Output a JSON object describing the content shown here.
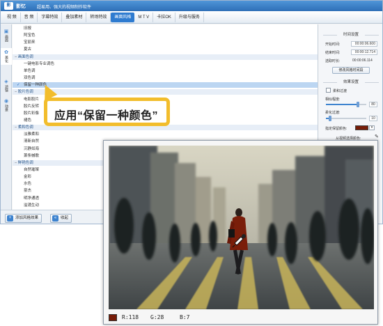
{
  "app": {
    "logo_text": "影",
    "name": "影忆",
    "subtitle": "超易用、强大的视频制作软件"
  },
  "menu": {
    "tabs": [
      {
        "label": "视 频"
      },
      {
        "label": "音 频"
      },
      {
        "label": "字幕特效"
      },
      {
        "label": "叠加素材"
      },
      {
        "label": "转场特效"
      },
      {
        "label": "画面风格",
        "active": true
      },
      {
        "label": "M T V"
      },
      {
        "label": "卡拉OK"
      },
      {
        "label": "升级与服务"
      }
    ]
  },
  "left_nav": [
    {
      "icon": "film-icon",
      "glyph": "▣",
      "label": "画面"
    },
    {
      "icon": "beautify-icon",
      "glyph": "✿",
      "label": "美化",
      "active": true
    },
    {
      "icon": "filter-icon",
      "glyph": "◈",
      "label": "滤镜"
    },
    {
      "icon": "motion-icon",
      "glyph": "◉",
      "label": "动景"
    }
  ],
  "effects": {
    "items": [
      {
        "label": "旧报",
        "type": "item"
      },
      {
        "label": "阿宝色",
        "type": "item"
      },
      {
        "label": "宝丽来",
        "type": "item"
      },
      {
        "label": "夏古",
        "type": "item"
      },
      {
        "label": "画面色调",
        "type": "category"
      },
      {
        "label": "一键电影专业调色",
        "type": "item"
      },
      {
        "label": "单色调",
        "type": "item"
      },
      {
        "label": "双色调",
        "type": "item"
      },
      {
        "label": "保留一种颜色",
        "type": "item",
        "selected": true
      },
      {
        "label": "胶片色调",
        "type": "category"
      },
      {
        "label": "电影胶片",
        "type": "item"
      },
      {
        "label": "胶片反转",
        "type": "item"
      },
      {
        "label": "胶片彩像",
        "type": "item"
      },
      {
        "label": "褪色",
        "type": "item"
      },
      {
        "label": "柔和色调",
        "type": "category"
      },
      {
        "label": "淡雅柔和",
        "type": "item"
      },
      {
        "label": "清新自然",
        "type": "item"
      },
      {
        "label": "沉静如海",
        "type": "item"
      },
      {
        "label": "萧条槭歌",
        "type": "item"
      },
      {
        "label": "鲜艳色调",
        "type": "category"
      },
      {
        "label": "自然璀璨",
        "type": "item"
      },
      {
        "label": "金彩",
        "type": "item"
      },
      {
        "label": "水色",
        "type": "item"
      },
      {
        "label": "豪杰",
        "type": "item"
      },
      {
        "label": "明净通透",
        "type": "item"
      },
      {
        "label": "溢涌生动",
        "type": "item"
      }
    ]
  },
  "bottom_bar": {
    "add_label": "添加风格效果",
    "collapse_label": "收起"
  },
  "right_panel": {
    "time_title": "时间设置",
    "start_label": "开始时间:",
    "start_value": "00:00:06.600",
    "end_label": "结束时间:",
    "end_value": "00:00:12.714",
    "selected_label": "选取时长:",
    "selected_value": "00:00:06.114",
    "edit_time_button": "修改风格时间段",
    "effect_title": "效果设置",
    "soft_transition_label": "柔和过渡",
    "similarity_label": "相似程度:",
    "similarity_value": "80",
    "similarity_fraction": 0.8,
    "soft_label": "柔化过渡:",
    "soft_value": "10",
    "soft_fraction": 0.1,
    "keep_color_label": "指定保留颜色:",
    "keep_color": "#761c07",
    "pick_label": "从视频选择颜色:"
  },
  "callout": {
    "text": "应用“保留一种颜色”"
  },
  "preview": {
    "picked_color": "#761c07",
    "r_label": "R:118",
    "g_label": "G:28",
    "b_label": "B:7"
  }
}
